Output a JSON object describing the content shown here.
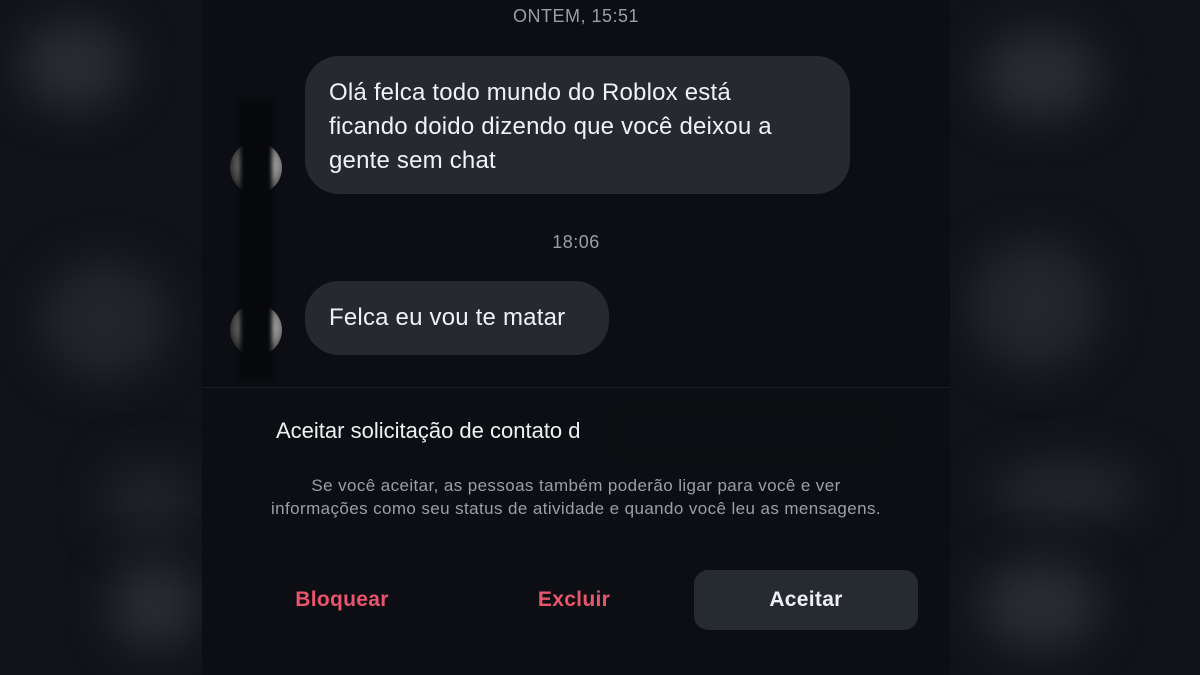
{
  "chat": {
    "messages": [
      {
        "timestamp": "ONTEM, 15:51",
        "text_lines": [
          "Olá felca todo mundo do Roblox está",
          "ficando doido dizendo que você deixou a",
          "gente sem chat"
        ]
      },
      {
        "timestamp": "18:06",
        "text_lines": [
          "Felca eu vou te matar"
        ]
      }
    ]
  },
  "request": {
    "title": "Aceitar solicitação de contato d",
    "description": "Se você aceitar, as pessoas também poderão ligar para você e ver informações como seu status de atividade e quando você leu as mensagens.",
    "buttons": {
      "block": "Bloquear",
      "delete": "Excluir",
      "accept": "Aceitar"
    }
  },
  "colors": {
    "background": "#0c0e13",
    "bubble": "#262930",
    "danger": "#e9566b",
    "accept_button": "#262a31"
  }
}
